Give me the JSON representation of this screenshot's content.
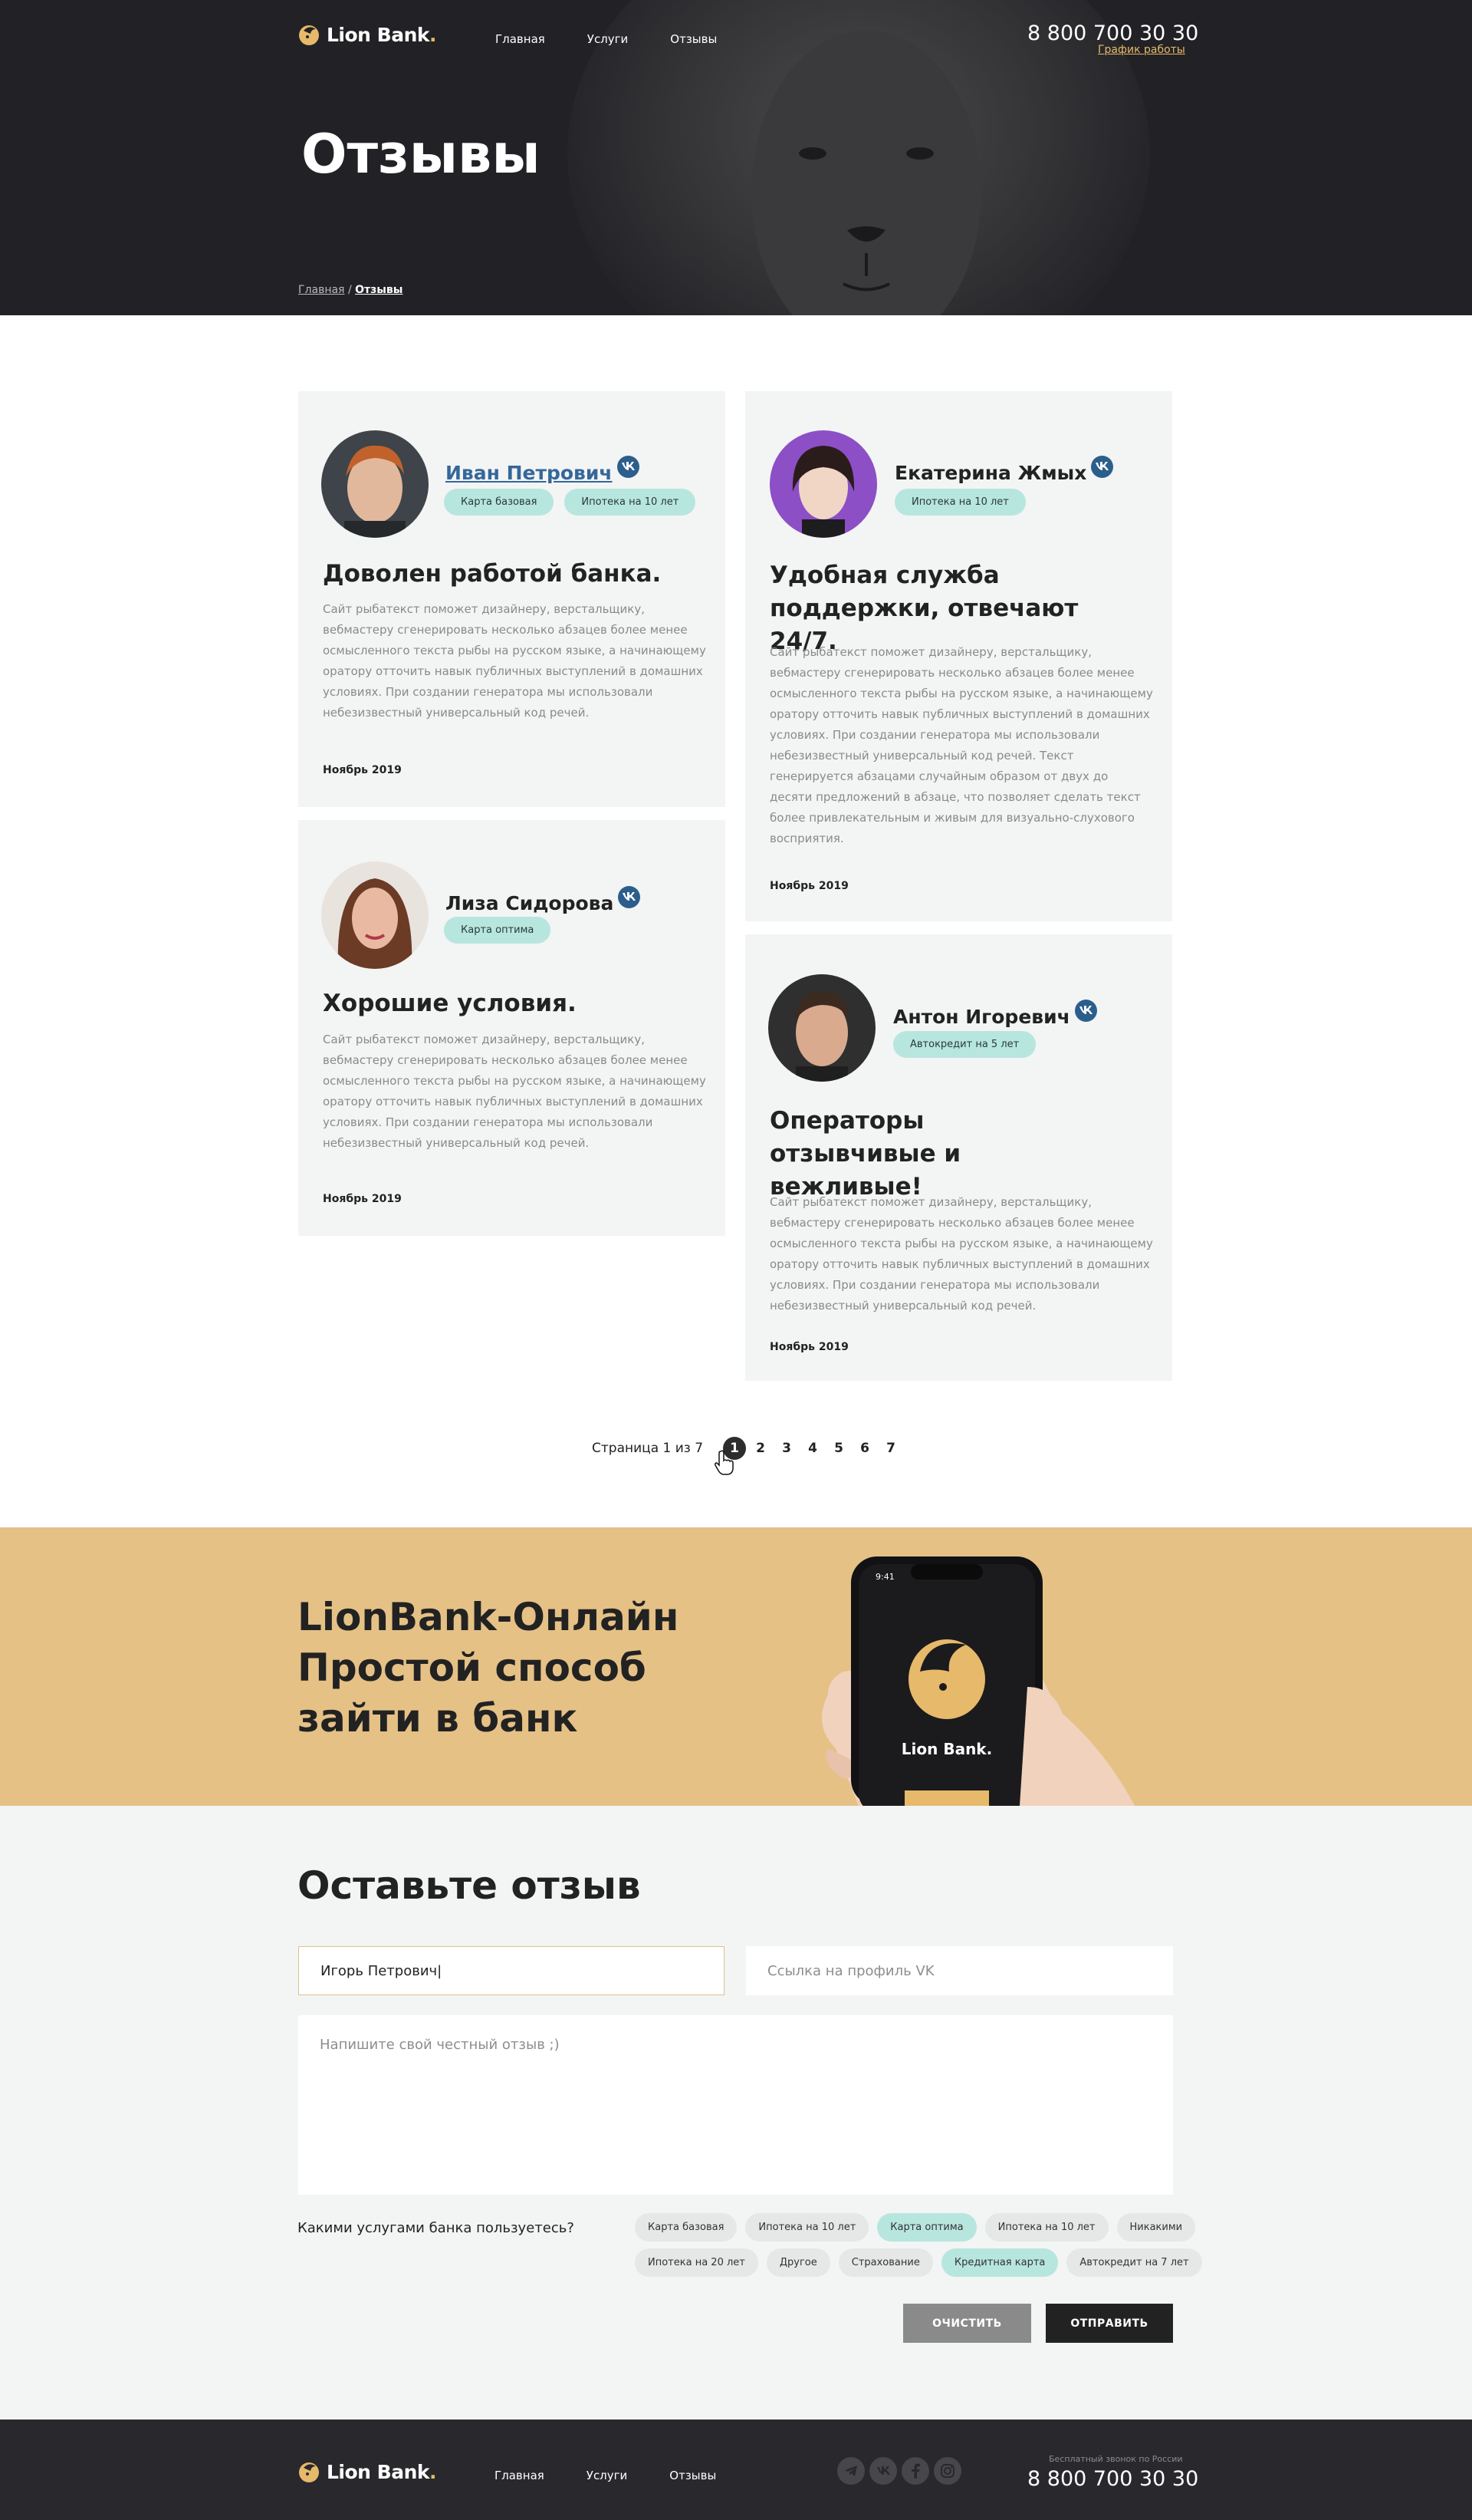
{
  "header": {
    "brand": "Lion Bank",
    "brand_dot": ".",
    "nav": [
      "Главная",
      "Услуги",
      "Отзывы"
    ],
    "phone": "8 800 700 30 30",
    "schedule": "График работы"
  },
  "hero": {
    "title": "Отзывы",
    "breadcrumb_home": "Главная",
    "breadcrumb_sep": "/",
    "breadcrumb_current": "Отзывы"
  },
  "reviews": [
    {
      "name": "Иван Петрович",
      "tags": [
        "Карта базовая",
        "Ипотека на 10 лет"
      ],
      "title": "Доволен работой банка.",
      "text": "Сайт рыбатекст поможет дизайнеру, верстальщику, вебмастеру сгенерировать несколько абзацев более менее осмысленного текста рыбы на русском языке, а начинающему оратору отточить навык публичных выступлений в домашних условиях. При создании генератора мы использовали небезизвестный универсальный код речей.",
      "date": "Ноябрь 2019"
    },
    {
      "name": "Екатерина Жмых",
      "tags": [
        "Ипотека на 10 лет"
      ],
      "title": "Удобная служба поддержки, отвечают 24/7.",
      "text": "Сайт рыбатекст поможет дизайнеру, верстальщику, вебмастеру сгенерировать несколько абзацев более менее осмысленного текста рыбы на русском языке, а начинающему оратору отточить навык публичных выступлений в домашних условиях. При создании генератора мы использовали небезизвестный универсальный код речей. Текст генерируется абзацами случайным образом от двух до десяти предложений в абзаце, что позволяет сделать текст более привлекательным и живым для визуально-слухового восприятия.",
      "date": "Ноябрь 2019"
    },
    {
      "name": "Лиза Сидорова",
      "tags": [
        "Карта оптима"
      ],
      "title": "Хорошие условия.",
      "text": "Сайт рыбатекст поможет дизайнеру, верстальщику, вебмастеру сгенерировать несколько абзацев более менее осмысленного текста рыбы на русском языке, а начинающему оратору отточить навык публичных выступлений в домашних условиях. При создании генератора мы использовали небезизвестный универсальный код речей.",
      "date": "Ноябрь 2019"
    },
    {
      "name": "Антон Игоревич",
      "tags": [
        "Автокредит на 5 лет"
      ],
      "title": "Операторы отзывчивые и вежливые!",
      "text": "Сайт рыбатекст поможет дизайнеру, верстальщику, вебмастеру сгенерировать несколько абзацев более менее осмысленного текста рыбы на русском языке, а начинающему оратору отточить навык публичных выступлений в домашних условиях. При создании генератора мы использовали небезизвестный универсальный код речей.",
      "date": "Ноябрь 2019"
    }
  ],
  "pagination": {
    "label": "Страница 1 из 7",
    "pages": [
      "1",
      "2",
      "3",
      "4",
      "5",
      "6",
      "7"
    ],
    "current": "1"
  },
  "promo": {
    "line1": "LionBank-Онлайн",
    "line2": "Простой способ",
    "line3": "зайти в банк",
    "phone_time": "9:41",
    "phone_brand": "Lion Bank."
  },
  "form": {
    "title": "Оставьте отзыв",
    "name_value": "Игорь Петрович|",
    "vk_placeholder": "Ссылка на профиль VK",
    "review_placeholder": "Напишите свой честный отзыв ;)",
    "question": "Какими услугами банка пользуетесь?",
    "services_row1": [
      {
        "label": "Карта  базовая",
        "selected": false
      },
      {
        "label": "Ипотека на 10 лет",
        "selected": false
      },
      {
        "label": "Карта оптима",
        "selected": true
      },
      {
        "label": "Ипотека на 10 лет",
        "selected": false
      },
      {
        "label": "Никакими",
        "selected": false
      }
    ],
    "services_row2": [
      {
        "label": "Ипотека на 20 лет",
        "selected": false
      },
      {
        "label": "Другое",
        "selected": false
      },
      {
        "label": "Страхование",
        "selected": false
      },
      {
        "label": "Кредитная карта",
        "selected": true
      },
      {
        "label": "Автокредит на 7 лет",
        "selected": false
      }
    ],
    "clear_label": "ОЧИСТИТЬ",
    "submit_label": "ОТПРАВИТЬ"
  },
  "footer": {
    "brand": "Lion Bank",
    "brand_dot": ".",
    "nav": [
      "Главная",
      "Услуги",
      "Отзывы"
    ],
    "free_call": "Бесплатный звонок по России",
    "phone": "8 800 700 30 30",
    "social_icons": [
      "telegram-icon",
      "vk-icon",
      "facebook-icon",
      "instagram-icon"
    ]
  },
  "colors": {
    "accent": "#e7b96a",
    "tag": "#b7e6df",
    "dark": "#222226",
    "promo": "#e5c186"
  }
}
